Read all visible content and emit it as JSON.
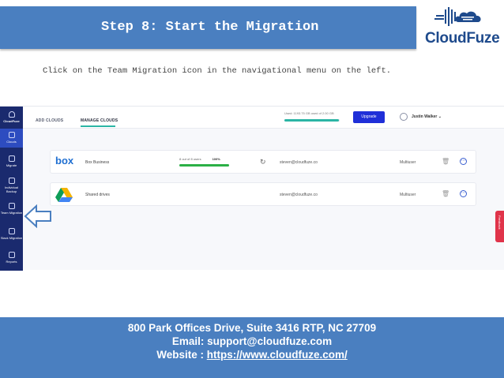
{
  "slide": {
    "title": "Step 8: Start the Migration",
    "instruction": "Click on the Team Migration icon in the navigational menu on the left.",
    "logo": {
      "name": "CloudFuze",
      "color": "#1e4a8c"
    },
    "colors": {
      "banner": "#4a7fc0",
      "sidebar": "#1a2a6e",
      "accent": "#2bb5a5",
      "upgrade": "#1f2fd8"
    }
  },
  "app": {
    "sidebar": {
      "logo_label": "CloudFuze",
      "items": [
        {
          "label": "Clouds",
          "icon": "cloud-icon"
        },
        {
          "label": "Migrate",
          "icon": "migrate-icon"
        },
        {
          "label": "Individual Backup",
          "icon": "backup-icon"
        },
        {
          "label": "Team Migration",
          "icon": "team-migration-icon"
        },
        {
          "label": "Slack Migration",
          "icon": "slack-migration-icon"
        },
        {
          "label": "Reports",
          "icon": "reports-icon"
        }
      ]
    },
    "top": {
      "tab_add": "ADD CLOUDS",
      "tab_manage": "MANAGE CLOUDS",
      "storage_text": "Used: 1193.75 GB used of 2.00 GB",
      "storage_fraction": 0.98,
      "upgrade_label": "Upgrade",
      "user_name": "Justin Walker"
    },
    "rows": [
      {
        "logo": "box",
        "name": "Box Business",
        "users_text": "8 out of 8 users",
        "users_percent": "100%",
        "progress": 1.0,
        "email": "steven@cloudfuze.co",
        "type": "Multiuser"
      },
      {
        "logo": "google-drive",
        "name": "Shared drives",
        "email": "steven@cloudfuze.co",
        "type": "Multiuser"
      }
    ],
    "feedback_label": "Feedback"
  },
  "footer": {
    "address": "800 Park Offices Drive, Suite 3416 RTP, NC 27709",
    "email": "Email: support@cloudfuze.com",
    "website_label": "Website : ",
    "website_url": "https://www.cloudfuze.com/"
  }
}
